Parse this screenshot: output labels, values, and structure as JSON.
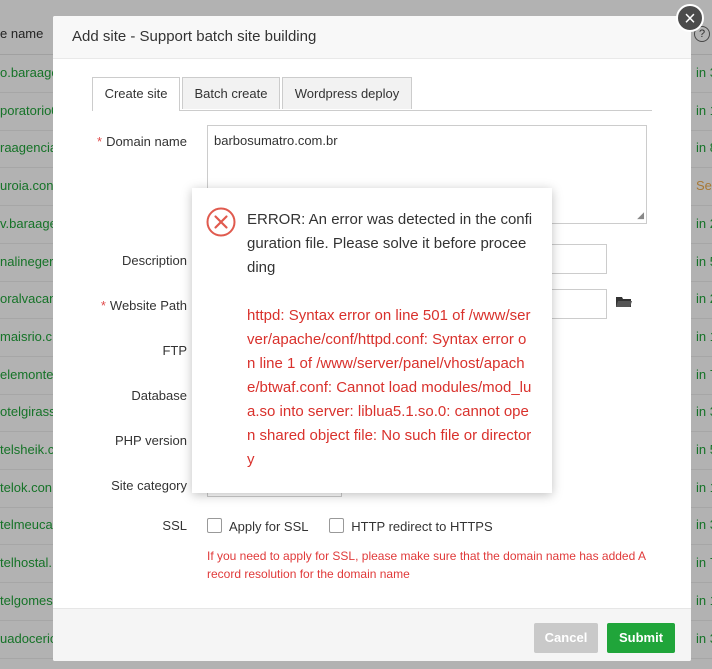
{
  "background": {
    "column_header": "e name",
    "help": "?",
    "rows": [
      {
        "site": "o.baraage",
        "expire": "in 3"
      },
      {
        "site": "poratorio0",
        "expire": "in 1"
      },
      {
        "site": "raagencia",
        "expire": "in 8"
      },
      {
        "site": "uroia.con",
        "expire": "Se",
        "warn": true
      },
      {
        "site": "v.baraage",
        "expire": "in 2"
      },
      {
        "site": "nalinegerp",
        "expire": "in 5"
      },
      {
        "site": "oralvacan",
        "expire": "in 2"
      },
      {
        "site": "maisrio.c",
        "expire": "in 1"
      },
      {
        "site": "elemonte",
        "expire": "in 7"
      },
      {
        "site": "otelgirasso",
        "expire": "in 3"
      },
      {
        "site": "telsheik.c",
        "expire": "in 5"
      },
      {
        "site": "telok.con",
        "expire": "in 1"
      },
      {
        "site": "telmeuca",
        "expire": "in 3"
      },
      {
        "site": "telhostal.",
        "expire": "in 7"
      },
      {
        "site": "telgomes",
        "expire": "in 1"
      },
      {
        "site": "uadocerio",
        "expire": "in 3"
      }
    ]
  },
  "modal": {
    "title": "Add site - Support batch site building",
    "close": "×",
    "tabs": [
      {
        "label": "Create site"
      },
      {
        "label": "Batch create"
      },
      {
        "label": "Wordpress deploy"
      }
    ],
    "labels": {
      "required_mark": "*",
      "domain": "Domain name",
      "description": "Description",
      "path": "Website Path",
      "ftp": "FTP",
      "database": "Database",
      "php": "PHP version",
      "category": "Site category",
      "ssl": "SSL"
    },
    "domain_value": "barbosumatro.com.br",
    "ssl_apply": "Apply for SSL",
    "ssl_redirect": "HTTP redirect to HTTPS",
    "ssl_note": "If you need to apply for SSL, please make sure that the domain name has added A record resolution for the domain name",
    "cancel": "Cancel",
    "submit": "Submit"
  },
  "error_dialog": {
    "title": "ERROR: An error was detected in the configuration file. Please solve it before proceeding",
    "detail": "httpd: Syntax error on line 501 of /www/server/apache/conf/httpd.conf: Syntax error on line 1 of /www/server/panel/vhost/apache/btwaf.conf: Cannot load modules/mod_lua.so into server: liblua5.1.so.0: cannot open shared object file: No such file or directory"
  },
  "colors": {
    "accent_green": "#20a53a",
    "error_red": "#d9312c"
  }
}
